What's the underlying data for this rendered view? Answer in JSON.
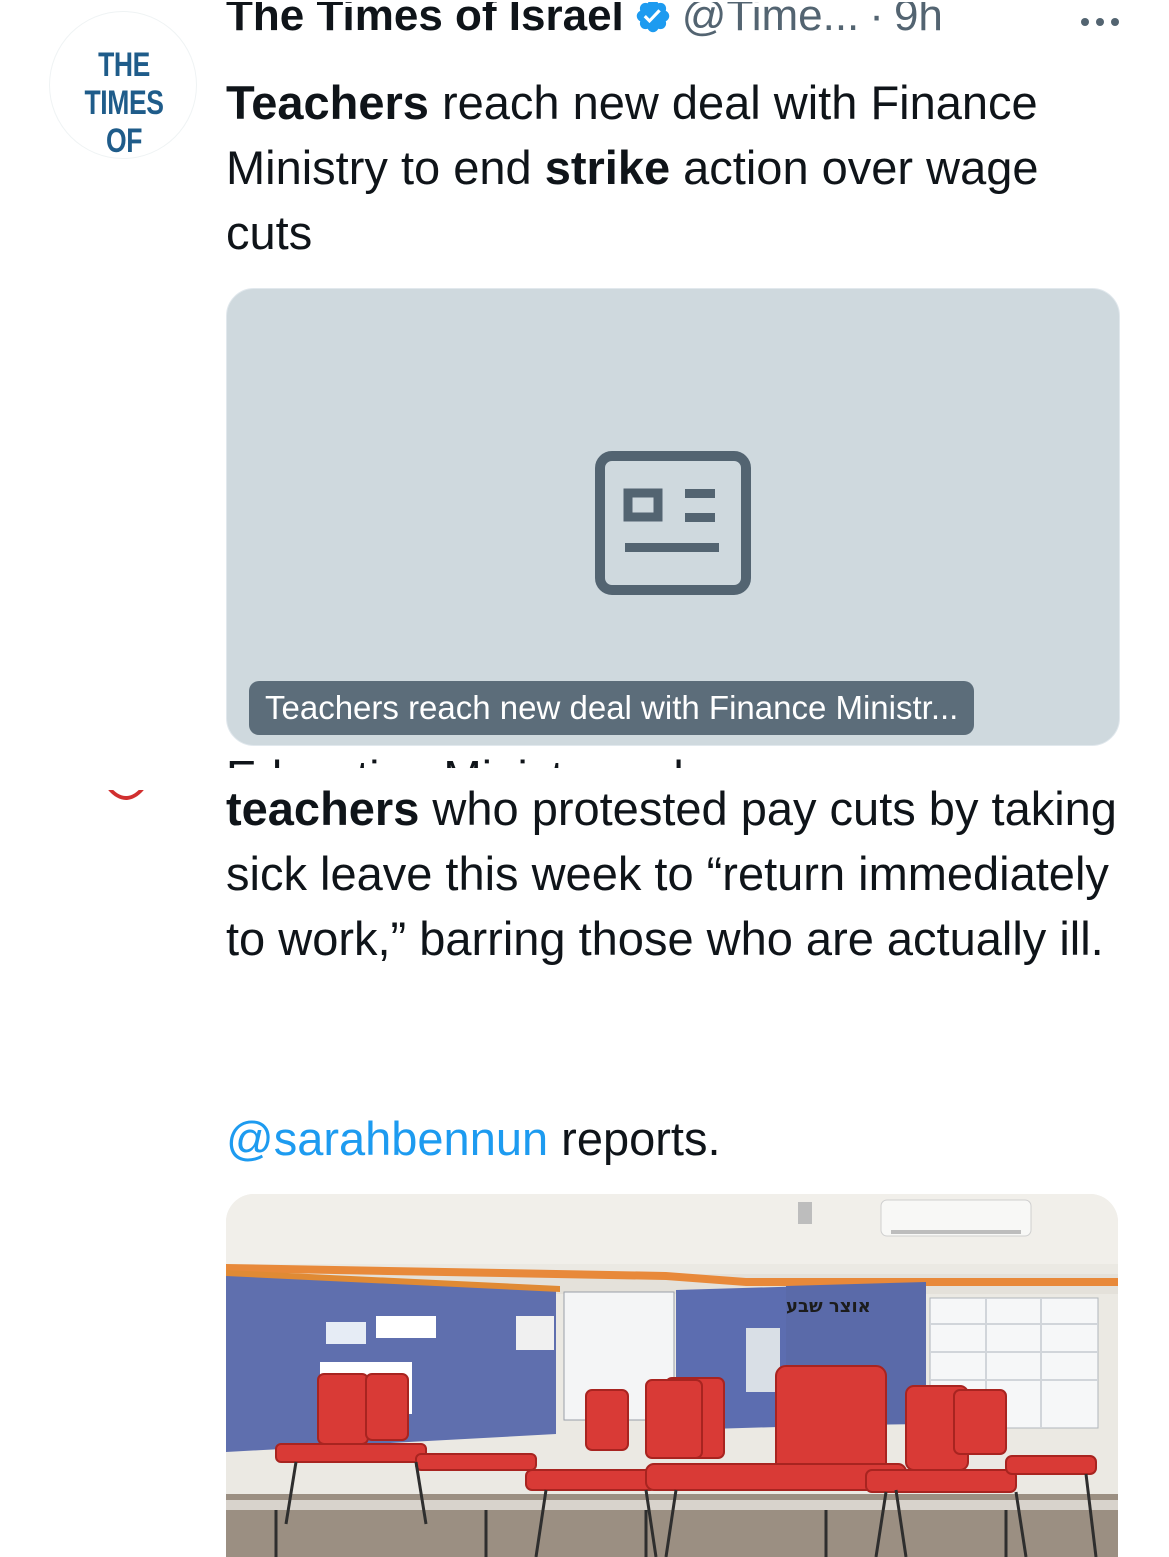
{
  "tweet1": {
    "avatar_text": [
      "THE TIMES",
      "OF ISRAEL"
    ],
    "author_name": "The Times of Israel",
    "handle": "@Time...",
    "separator": "·",
    "time": "9h",
    "text_parts": [
      {
        "text": "Teachers",
        "bold": true
      },
      {
        "text": " reach new deal with Finance Ministry to end ",
        "bold": false
      },
      {
        "text": "strike",
        "bold": true
      },
      {
        "text": " action over wage cuts",
        "bold": false
      }
    ],
    "card": {
      "icon": "news-article-icon",
      "caption": "Teachers reach new deal with Finance Ministr..."
    }
  },
  "tweet2": {
    "cutoff_line": "Education Minister orders",
    "text_parts": [
      {
        "text": "teachers",
        "bold": true
      },
      {
        "text": " who protested pay cuts by taking sick leave this week to “return immediately to work,” barring those who are actually ill.",
        "bold": false
      }
    ],
    "mention": "@sarahbennun",
    "after_mention": " reports.",
    "photo_sign": "אוצר שבע"
  },
  "colors": {
    "text": "#0f1419",
    "secondary": "#536471",
    "link": "#1d9bf0",
    "verified": "#1d9bf0",
    "card_bg": "#cfd9de",
    "logo": "#1f5c8a",
    "chair": "#d93a36"
  }
}
